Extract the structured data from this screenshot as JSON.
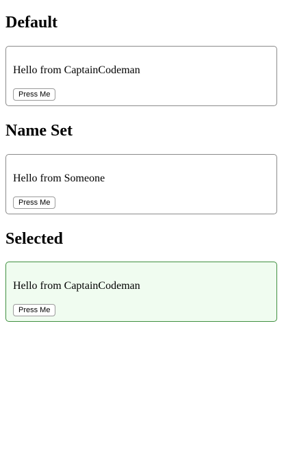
{
  "sections": [
    {
      "title": "Default",
      "greeting": "Hello from CaptainCodeman",
      "button_label": "Press Me"
    },
    {
      "title": "Name Set",
      "greeting": "Hello from Someone",
      "button_label": "Press Me"
    },
    {
      "title": "Selected",
      "greeting": "Hello from CaptainCodeman",
      "button_label": "Press Me"
    }
  ],
  "colors": {
    "card_border": "#8a8a8a",
    "selected_border": "#3f8f3f",
    "selected_background": "#f0fcf0"
  }
}
